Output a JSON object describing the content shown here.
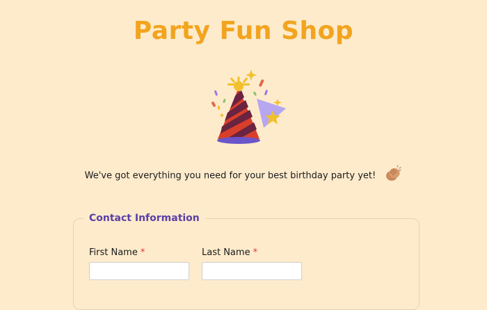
{
  "header": {
    "title": "Party Fun Shop"
  },
  "hero": {
    "icon": "party-hat-icon"
  },
  "intro": {
    "text": "We've got everything you need for your best birthday party yet!",
    "emoji": "clapping-hands-icon"
  },
  "form": {
    "section_title": "Contact Information",
    "fields": [
      {
        "label": "First Name",
        "required_marker": "*",
        "value": "",
        "placeholder": ""
      },
      {
        "label": "Last Name",
        "required_marker": "*",
        "value": "",
        "placeholder": ""
      }
    ]
  },
  "colors": {
    "background": "#fdebcc",
    "title": "#f2a41f",
    "section_title": "#5b3fa6",
    "required": "#e0382f"
  }
}
